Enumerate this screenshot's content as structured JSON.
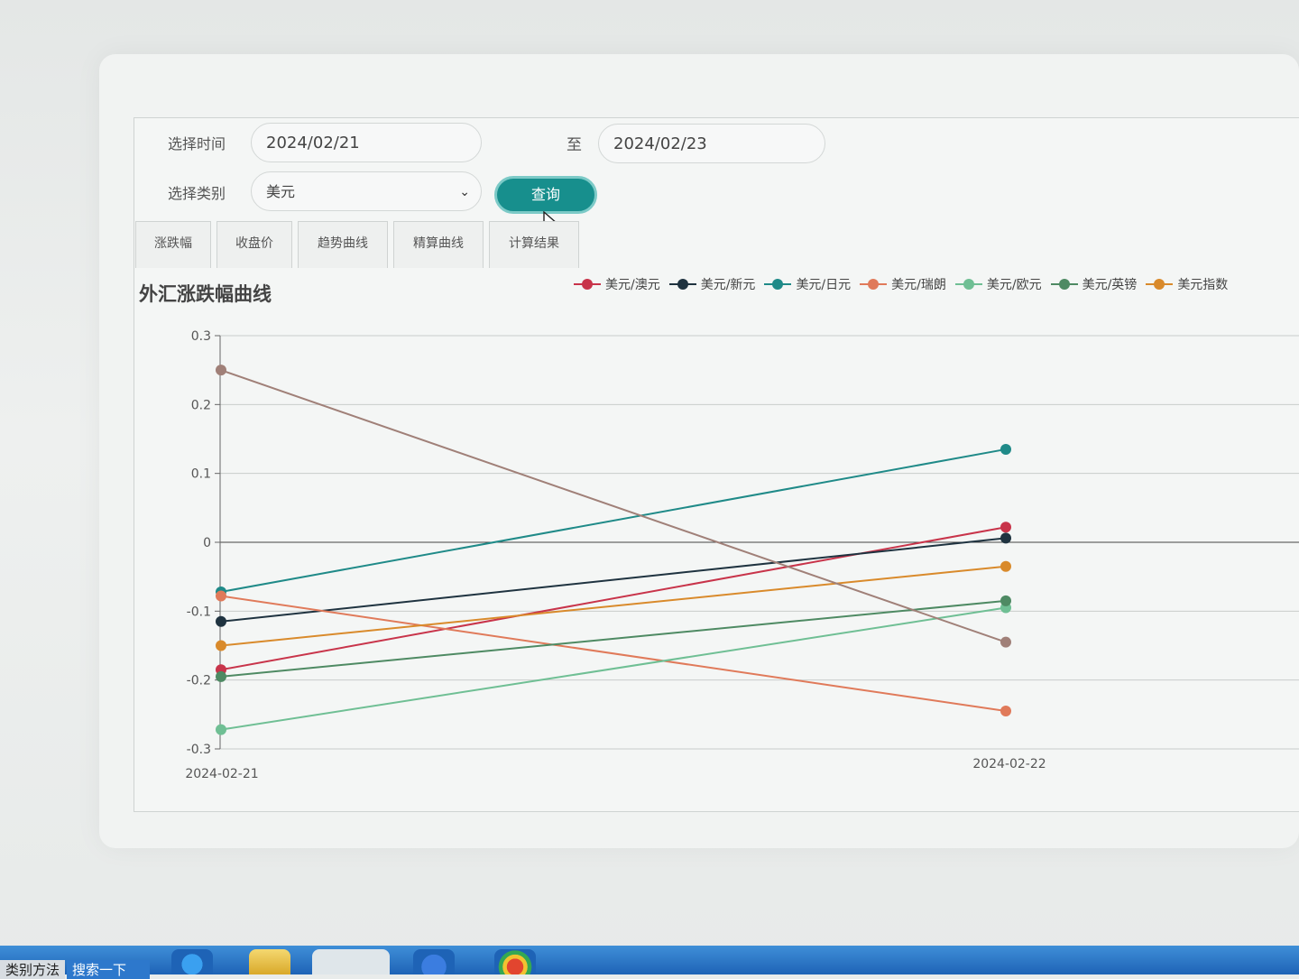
{
  "form": {
    "time_label": "选择时间",
    "date_from": "2024/02/21",
    "to_label": "至",
    "date_to": "2024/02/23",
    "category_label": "选择类别",
    "category_value": "美元",
    "query_label": "查询"
  },
  "tabs": [
    {
      "label": "涨跌幅"
    },
    {
      "label": "收盘价"
    },
    {
      "label": "趋势曲线"
    },
    {
      "label": "精算曲线"
    },
    {
      "label": "计算结果"
    }
  ],
  "taskbar": {
    "left_text": "类别方法",
    "search_text": "搜索一下"
  },
  "colors": {
    "accent": "#178f8d",
    "page_bg": "#f4f6f5"
  },
  "chart_data": {
    "type": "line",
    "title": "外汇涨跌幅曲线",
    "x": [
      "2024-02-21",
      "2024-02-22"
    ],
    "ylim": [
      -0.3,
      0.3
    ],
    "yticks": [
      0.3,
      0.2,
      0.1,
      0,
      -0.1,
      -0.2,
      -0.3
    ],
    "ytick_labels": [
      "0.3",
      "0.2",
      "0.1",
      "0",
      "-0.1",
      "-0.2",
      "-0.3"
    ],
    "grid": true,
    "legend_position": "top-right",
    "series": [
      {
        "name": "美元/澳元",
        "color": "#c8344a",
        "values": [
          -0.185,
          0.022
        ]
      },
      {
        "name": "美元/新元",
        "color": "#1f3340",
        "values": [
          -0.115,
          0.006
        ]
      },
      {
        "name": "美元/日元",
        "color": "#1f8a88",
        "values": [
          -0.072,
          0.135
        ]
      },
      {
        "name": "美元/瑞朗",
        "color": "#e07a5a",
        "values": [
          -0.078,
          -0.245
        ]
      },
      {
        "name": "美元/欧元",
        "color": "#6fbf94",
        "values": [
          -0.272,
          -0.095
        ]
      },
      {
        "name": "美元/英镑",
        "color": "#4e8a63",
        "values": [
          -0.195,
          -0.085
        ]
      },
      {
        "name": "美元指数",
        "color": "#d98a2b",
        "values": [
          -0.15,
          -0.035
        ]
      },
      {
        "color": "#a08078",
        "values": [
          0.25,
          -0.145
        ]
      }
    ]
  }
}
